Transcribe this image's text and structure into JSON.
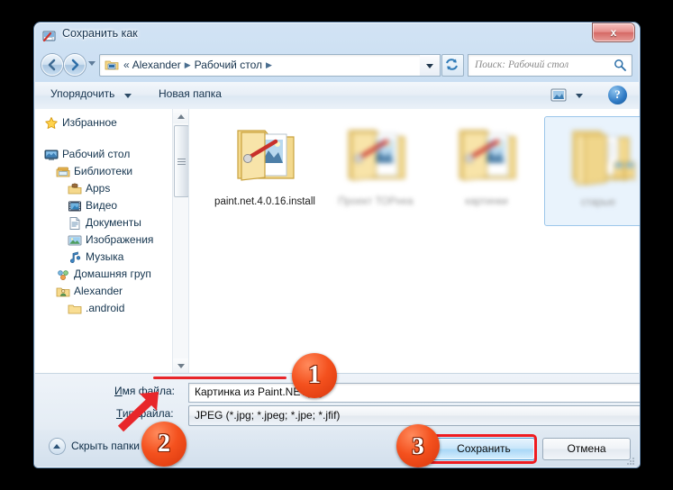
{
  "window": {
    "title": "Сохранить как",
    "title_icon": "save-as-icon",
    "close_label": "x"
  },
  "nav": {
    "back_icon": "back-arrow-icon",
    "forward_icon": "forward-arrow-icon",
    "recent_dropdown_icon": "chevron-down-icon",
    "address_icon": "desktop-folder-icon",
    "breadcrumb_prefix": "«",
    "breadcrumbs": [
      "Alexander",
      "Рабочий стол"
    ],
    "address_dropdown_icon": "chevron-down-icon",
    "refresh_icon": "refresh-icon",
    "search_placeholder": "Поиск: Рабочий стол",
    "search_icon": "search-icon"
  },
  "commandbar": {
    "organize_label": "Упорядочить",
    "organize_caret_icon": "chevron-down-icon",
    "new_folder_label": "Новая папка",
    "view_icon": "view-layout-icon",
    "view_caret_icon": "chevron-down-icon",
    "help_icon": "help-icon",
    "help_label": "?"
  },
  "sidebar": {
    "items": [
      {
        "label": "Избранное",
        "icon": "star-icon",
        "indent": 0,
        "gap_after": true
      },
      {
        "label": "Рабочий стол",
        "icon": "desktop-icon",
        "indent": 0
      },
      {
        "label": "Библиотеки",
        "icon": "libraries-icon",
        "indent": 1
      },
      {
        "label": "Apps",
        "icon": "apps-folder-icon",
        "indent": 2
      },
      {
        "label": "Видео",
        "icon": "video-icon",
        "indent": 2
      },
      {
        "label": "Документы",
        "icon": "documents-icon",
        "indent": 2
      },
      {
        "label": "Изображения",
        "icon": "pictures-icon",
        "indent": 2
      },
      {
        "label": "Музыка",
        "icon": "music-icon",
        "indent": 2
      },
      {
        "label": "Домашняя груп",
        "icon": "homegroup-icon",
        "indent": 1
      },
      {
        "label": "Alexander",
        "icon": "user-folder-icon",
        "indent": 1
      },
      {
        "label": ".android",
        "icon": "folder-icon",
        "indent": 2
      }
    ],
    "scrollbar": {
      "up_icon": "scroll-up-icon",
      "down_icon": "scroll-down-icon"
    }
  },
  "files": {
    "items": [
      {
        "label": "paint.net.4.0.16.install",
        "icon": "folder-picture-icon",
        "blurred": false,
        "selected": false
      },
      {
        "label": "Проект ТОРнеа",
        "icon": "folder-picture-icon",
        "blurred": true,
        "selected": false
      },
      {
        "label": "картинки",
        "icon": "folder-picture-icon",
        "blurred": true,
        "selected": false
      },
      {
        "label": "старые",
        "icon": "folder-documents-icon",
        "blurred": true,
        "selected": true
      }
    ]
  },
  "form": {
    "filename": {
      "label_pre": "И",
      "label_post": "мя файла:",
      "value": "Картинка из Paint.NET.jpg",
      "dropdown_icon": "chevron-down-icon"
    },
    "filetype": {
      "label_pre": "Т",
      "label_post": "ип файла:",
      "value": "JPEG (*.jpg; *.jpeg; *.jpe; *.jfif)",
      "dropdown_icon": "chevron-down-icon"
    }
  },
  "footer": {
    "hide_folders_label": "Скрыть папки",
    "hide_folders_icon": "chevron-up-circle-icon",
    "save_label": "Сохранить",
    "cancel_label": "Отмена",
    "resize_grip_icon": "resize-grip-icon"
  },
  "annotations": {
    "markers": [
      {
        "number": "1"
      },
      {
        "number": "2"
      },
      {
        "number": "3"
      }
    ],
    "color": "#f4511e",
    "highlight_color": "#ef1b20"
  }
}
